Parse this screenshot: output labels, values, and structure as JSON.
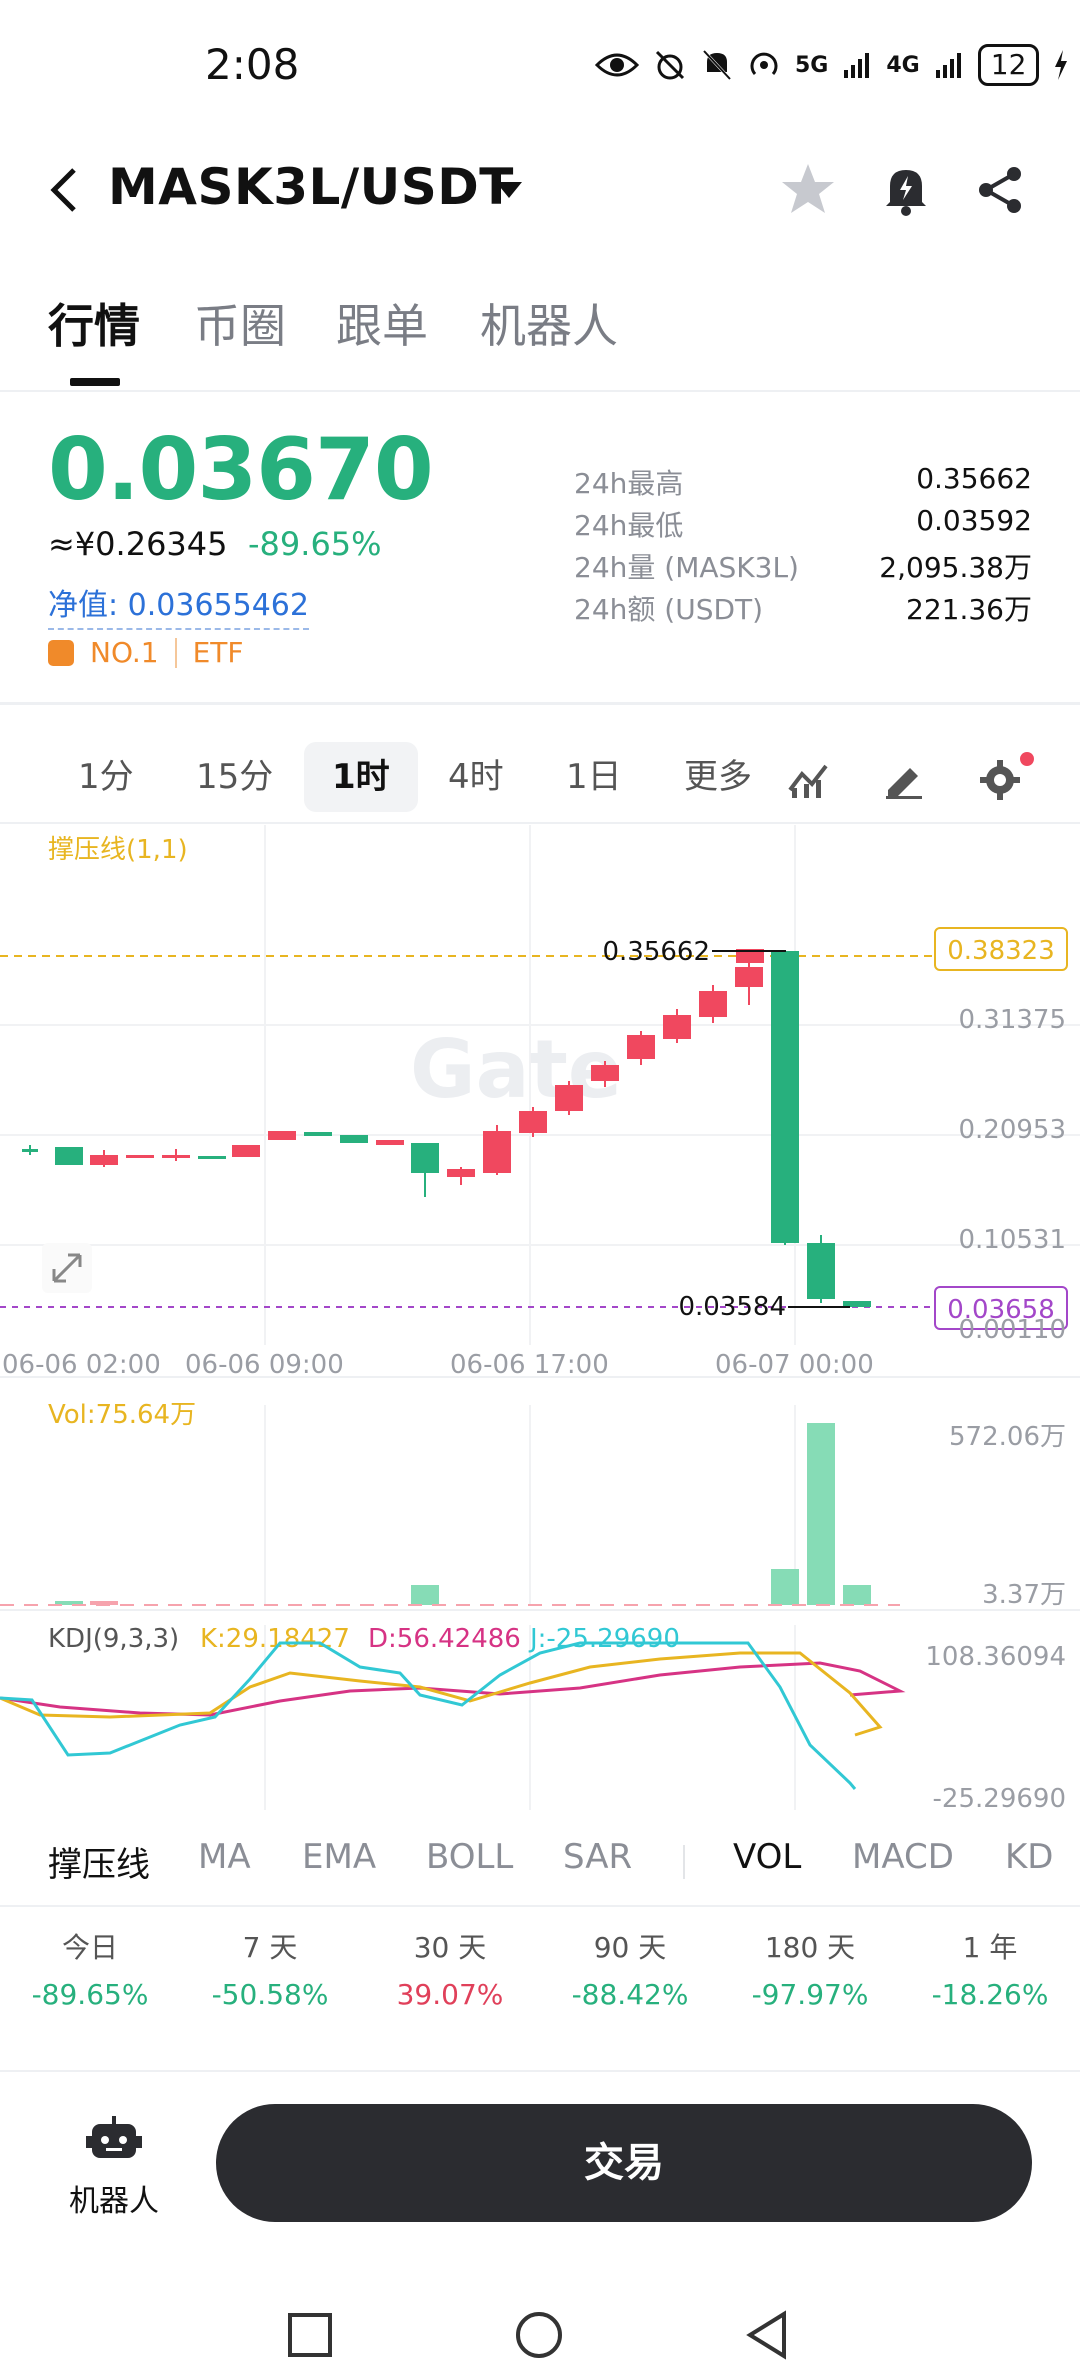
{
  "status": {
    "time": "2:08",
    "battery": "12",
    "net1": "5G",
    "net2": "4G"
  },
  "header": {
    "pair": "MASK3L/USDT"
  },
  "tabs": [
    "行情",
    "币圈",
    "跟单",
    "机器人"
  ],
  "price": {
    "last": "0.03670",
    "cny": "≈¥0.26345",
    "change": "-89.65%",
    "nav": "净值: 0.03655462",
    "rank": "NO.1",
    "tag": "ETF"
  },
  "stats": [
    {
      "label": "24h最高",
      "value": "0.35662"
    },
    {
      "label": "24h最低",
      "value": "0.03592"
    },
    {
      "label": "24h量 (MASK3L)",
      "value": "2,095.38万"
    },
    {
      "label": "24h额 (USDT)",
      "value": "221.36万"
    }
  ],
  "timeframes": [
    "1分",
    "15分",
    "1时",
    "4时",
    "1日",
    "更多"
  ],
  "chart": {
    "indicator_label": "撑压线(1,1)",
    "resistance": "0.38323",
    "current": "0.03658",
    "y_ticks": [
      "0.31375",
      "0.20953",
      "0.10531",
      "0.00110"
    ],
    "x_ticks": [
      "06-06 02:00",
      "06-06 09:00",
      "06-06 17:00",
      "06-07 00:00"
    ],
    "high_label": "0.35662",
    "low_label": "0.03584",
    "vol_label": "Vol:75.64万",
    "vol_max": "572.06万",
    "vol_min": "3.37万",
    "kdj_label": "KDJ(9,3,3)",
    "kdj_k": "K:29.18427",
    "kdj_d": "D:56.42486",
    "kdj_j": "J:-25.29690",
    "kdj_max": "108.36094",
    "kdj_min": "-25.29690",
    "watermark": "Gate",
    "colors": {
      "up": "#27b07d",
      "down": "#f0485f",
      "k": "#e8b521",
      "d": "#d63384",
      "j": "#31c8d4"
    }
  },
  "indicators": [
    "撑压线",
    "MA",
    "EMA",
    "BOLL",
    "SAR",
    "VOL",
    "MACD",
    "KD"
  ],
  "performance": [
    {
      "label": "今日",
      "value": "-89.65%",
      "dir": "down"
    },
    {
      "label": "7 天",
      "value": "-50.58%",
      "dir": "down"
    },
    {
      "label": "30 天",
      "value": "39.07%",
      "dir": "up"
    },
    {
      "label": "90 天",
      "value": "-88.42%",
      "dir": "down"
    },
    {
      "label": "180 天",
      "value": "-97.97%",
      "dir": "down"
    },
    {
      "label": "1 年",
      "value": "-18.26%",
      "dir": "down"
    }
  ],
  "bottom": {
    "robot_label": "机器人",
    "trade_label": "交易"
  }
}
